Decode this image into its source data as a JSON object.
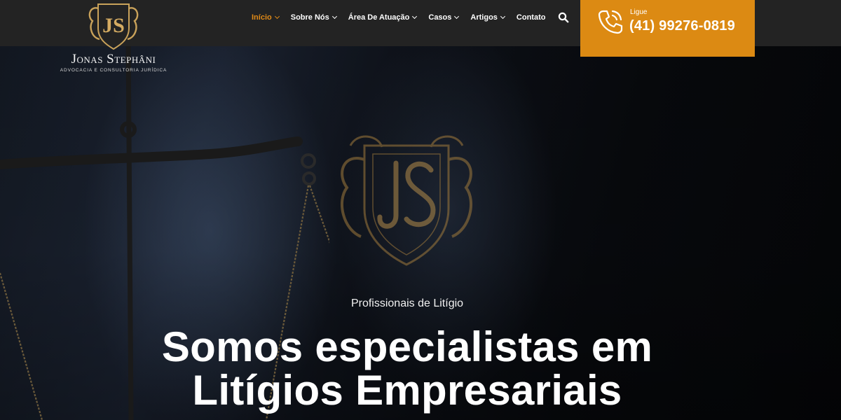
{
  "brand": {
    "monogram": "JS",
    "name": "Jonas Stephâni",
    "tagline": "ADVOCACIA E CONSULTORIA JURÍDICA"
  },
  "nav": {
    "items": [
      {
        "label": "Início",
        "active": true,
        "has_dropdown": true
      },
      {
        "label": "Sobre Nós",
        "active": false,
        "has_dropdown": true
      },
      {
        "label": "Área De Atuação",
        "active": false,
        "has_dropdown": true
      },
      {
        "label": "Casos",
        "active": false,
        "has_dropdown": true
      },
      {
        "label": "Artigos",
        "active": false,
        "has_dropdown": true
      },
      {
        "label": "Contato",
        "active": false,
        "has_dropdown": false
      }
    ],
    "search_icon": "search-icon"
  },
  "contact": {
    "label": "Ligue",
    "phone": "(41) 99276-0819",
    "icon": "phone-icon"
  },
  "hero": {
    "eyebrow": "Profissionais de Litígio",
    "headline_line1": "Somos especialistas em",
    "headline_line2": "Litígios Empresariais"
  },
  "colors": {
    "accent": "#dc8a13",
    "header_bg": "#232323",
    "gold": "#b8893f",
    "active_nav": "#e08a17"
  }
}
